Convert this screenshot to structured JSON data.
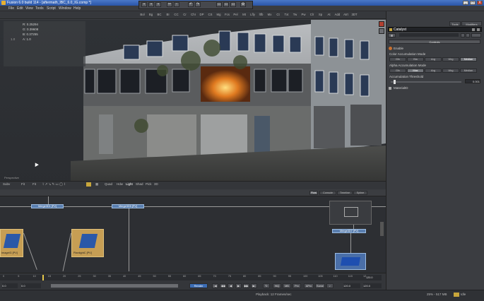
{
  "window": {
    "title": "Fusion 6.0 build 114 - [aftermath_IBC_6.0_IG.comp *]",
    "min": "_",
    "max": "□",
    "close": "X"
  },
  "menu": [
    "File",
    "Edit",
    "View",
    "Tools",
    "Script",
    "Window",
    "Help"
  ],
  "toolbar": {
    "tools": [
      "Bol",
      "Bg",
      "BC",
      "BI",
      "CC",
      "Cr",
      "ChI",
      "DP",
      "CS",
      "Mg",
      "Fcs",
      "Pel",
      "Mt",
      "Lfly",
      "ltfb",
      "Mx",
      "Ct",
      "Txt",
      "Tw",
      "Pw",
      "Clr",
      "Sp",
      "At",
      "Add",
      "Atrt",
      "3DT"
    ]
  },
  "viewer": {
    "label": "Perspective",
    "name": "Merge3D1",
    "readout": {
      "r": "R: 0.25294",
      "g": "G: 0.39608",
      "b": "B: 0.37255",
      "a": "A: 1.0",
      "x": "1.0"
    }
  },
  "viewer_toolbar": {
    "items": [
      "Subv",
      "Fit",
      "Fit",
      "Quad",
      "Hdw",
      "Light",
      "Shad",
      "Pick",
      "3D"
    ]
  },
  "inspector": {
    "tabs": [
      "Tools",
      "Modifiers"
    ],
    "tool_name": "Catalyst",
    "controls_tab": "Controls",
    "enable_label": "Enable",
    "color_mode_label": "Color Accumulation Mode",
    "color_mode_options": [
      "Gfx",
      "Bla",
      "Arg",
      "Wrg",
      "Median"
    ],
    "alpha_mode_label": "Alpha Accumulation Mode",
    "alpha_mode_options": [
      "Gfx",
      "Max",
      "Arg",
      "Wrg",
      "Median"
    ],
    "threshold_label": "Accumulation Threshold",
    "threshold_value": "0.001",
    "material_label": "MaterialID"
  },
  "flow": {
    "tabs": [
      "Flow",
      "Console",
      "Timeline",
      "Spline"
    ],
    "nodes": [
      "Merge3D1 [PV]",
      "Merge3D5 [PV]",
      "Merge3D7 [PV]",
      "ImageIG [PV]",
      "PlantightC [PV]"
    ]
  },
  "timeline": {
    "ticks": [
      "0",
      "5",
      "10",
      "15",
      "20",
      "25",
      "30",
      "35",
      "40",
      "45",
      "50",
      "55",
      "60",
      "65",
      "70",
      "75",
      "80",
      "85",
      "90",
      "95",
      "100",
      "105",
      "110",
      "115",
      "120"
    ],
    "start": "0.0",
    "current": "0.0",
    "end": "120.0",
    "end2": "120.0",
    "render_label": "Render",
    "play": [
      "|◀",
      "◀◀",
      "◀",
      "▶",
      "▶▶",
      "▶|"
    ],
    "hiq": "HiQ",
    "mb": "MB",
    "prx": "Prx",
    "aprx": "APrx",
    "some": "Some"
  },
  "status": {
    "left": "Playback: 12 Frames/sec",
    "right": "25% - 517 MB",
    "idle": "Idle"
  },
  "colors": {
    "accent": "#5a7fb0",
    "title": "#2a55a8"
  }
}
